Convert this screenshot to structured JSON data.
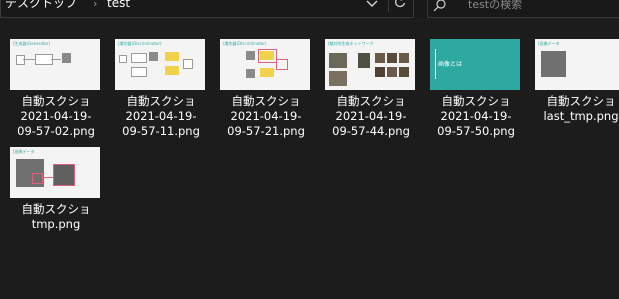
{
  "address_bar": {
    "breadcrumbs": [
      "デスクトップ",
      "test"
    ],
    "separator": "›",
    "dropdown_icon": "chevron-down-icon",
    "refresh_icon": "refresh-icon"
  },
  "search": {
    "placeholder": "testの検索",
    "icon": "search-icon"
  },
  "files": [
    {
      "name": "自動スクショ\n2021-04-19-\n09-57-02.png",
      "thumb_title": "[生成器(Generator)"
    },
    {
      "name": "自動スクショ\n2021-04-19-\n09-57-11.png",
      "thumb_title": "[識別器(Discriminator)"
    },
    {
      "name": "自動スクショ\n2021-04-19-\n09-57-21.png",
      "thumb_title": "[識別器(Discriminator)"
    },
    {
      "name": "自動スクショ\n2021-04-19-\n09-57-44.png",
      "thumb_title": "[敵対的生成ネットワーク"
    },
    {
      "name": "自動スクショ\n2021-04-19-\n09-57-50.png",
      "thumb_title": "画像とは"
    },
    {
      "name": "自動スクショ\nlast_tmp.png",
      "thumb_title": "[画像データ"
    },
    {
      "name": "自動スクショ\ntmp.png",
      "thumb_title": "[画像データ"
    }
  ],
  "colors": {
    "background": "#1c1c1c",
    "accent_teal": "#2ea8a0",
    "thumb_bg": "#f4f4f4"
  }
}
